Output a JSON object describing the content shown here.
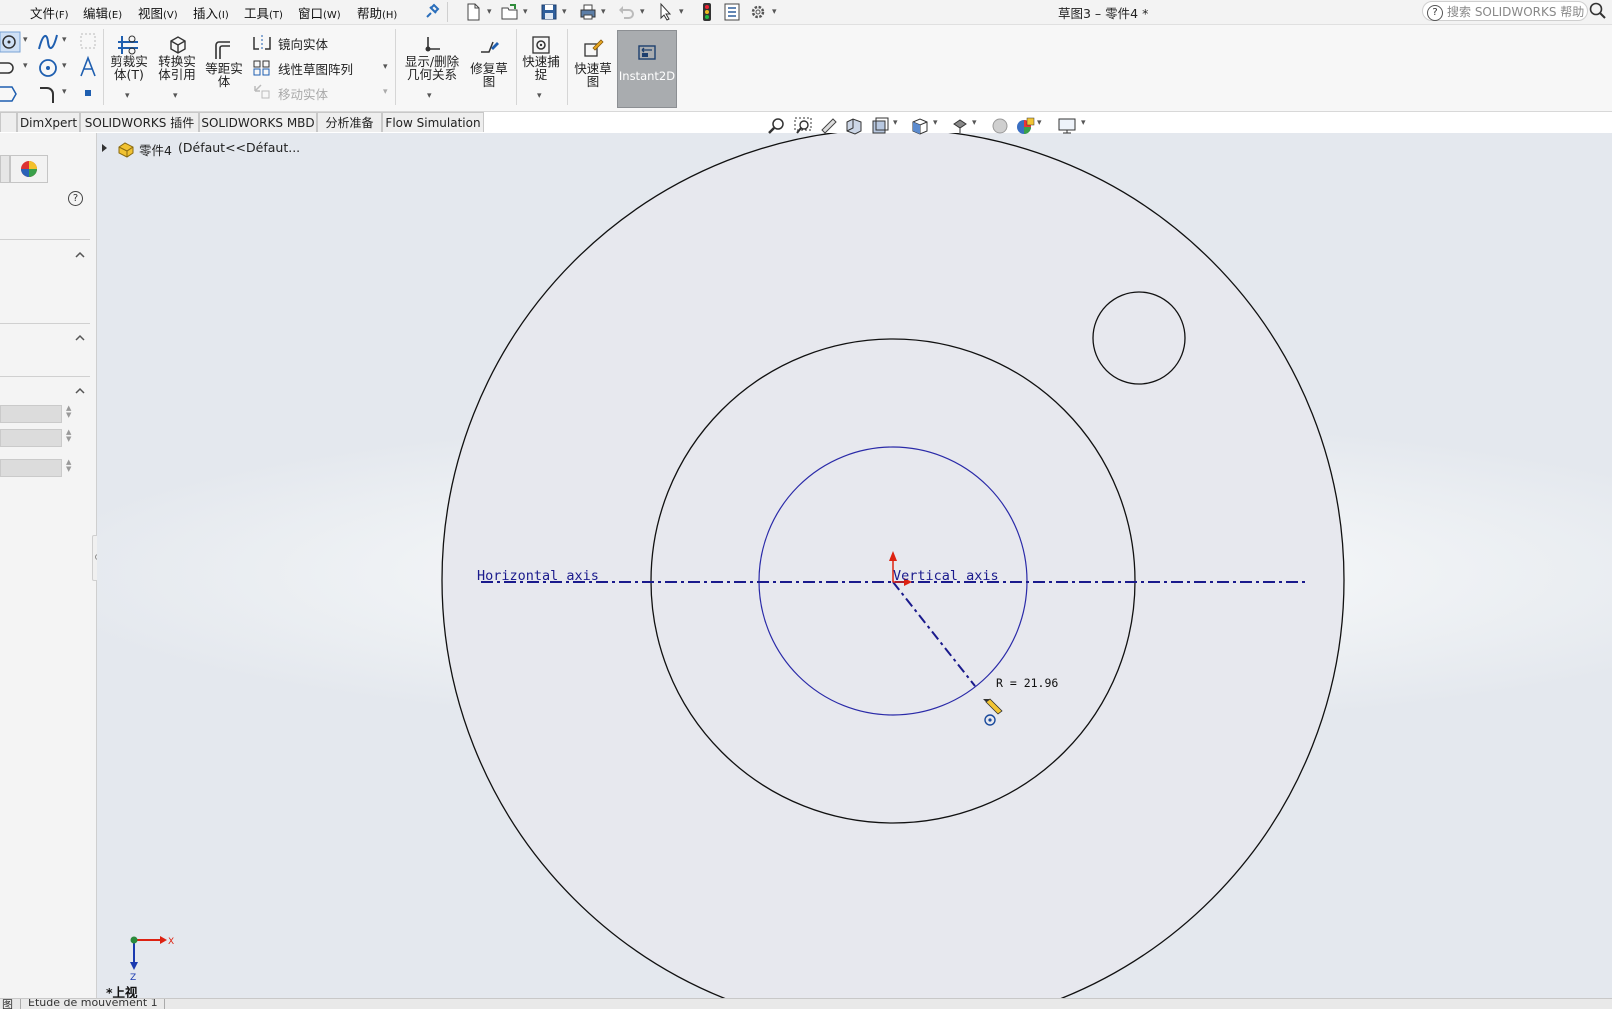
{
  "menubar": {
    "items": [
      {
        "label": "文件",
        "hotkey": "(F)"
      },
      {
        "label": "编辑",
        "hotkey": "(E)"
      },
      {
        "label": "视图",
        "hotkey": "(V)"
      },
      {
        "label": "插入",
        "hotkey": "(I)"
      },
      {
        "label": "工具",
        "hotkey": "(T)"
      },
      {
        "label": "窗口",
        "hotkey": "(W)"
      },
      {
        "label": "帮助",
        "hotkey": "(H)"
      }
    ],
    "document_title": "草图3 – 零件4 *",
    "help_search_placeholder": "搜索 SOLIDWORKS 帮助"
  },
  "toolbar": {
    "trim": "剪裁实体(T)",
    "convert_1": "转换实",
    "convert_2": "体引用",
    "offset_1": "等距实",
    "offset_2": "体",
    "mirror": "镜向实体",
    "linear_pattern": "线性草图阵列",
    "move": "移动实体",
    "relations_1": "显示/删除",
    "relations_2": "几何关系",
    "repair_1": "修复草",
    "repair_2": "图",
    "quick_snap_1": "快速捕",
    "quick_snap_2": "捉",
    "rapid_sketch_1": "快速草",
    "rapid_sketch_2": "图",
    "instant2d": "Instant2D"
  },
  "tabs": [
    "DimXpert",
    "SOLIDWORKS 插件",
    "SOLIDWORKS MBD",
    "分析准备",
    "Flow Simulation"
  ],
  "feature_tree": {
    "part_name": "零件4",
    "config": "(Défaut<<Défaut..."
  },
  "canvas": {
    "horizontal_axis_label": "Horizontal axis",
    "vertical_axis_label": "Vertical axis",
    "radius_readout": "R = 21.96",
    "view_name": "*上视",
    "triad_x": "X",
    "triad_z": "Z",
    "sketch_color": "#2a2aa8",
    "geometry_color": "#111111",
    "fill_color": "#e7e8ee"
  },
  "statusbar": {
    "left_tab": "图",
    "study_tab": "Etude de mouvement 1"
  }
}
